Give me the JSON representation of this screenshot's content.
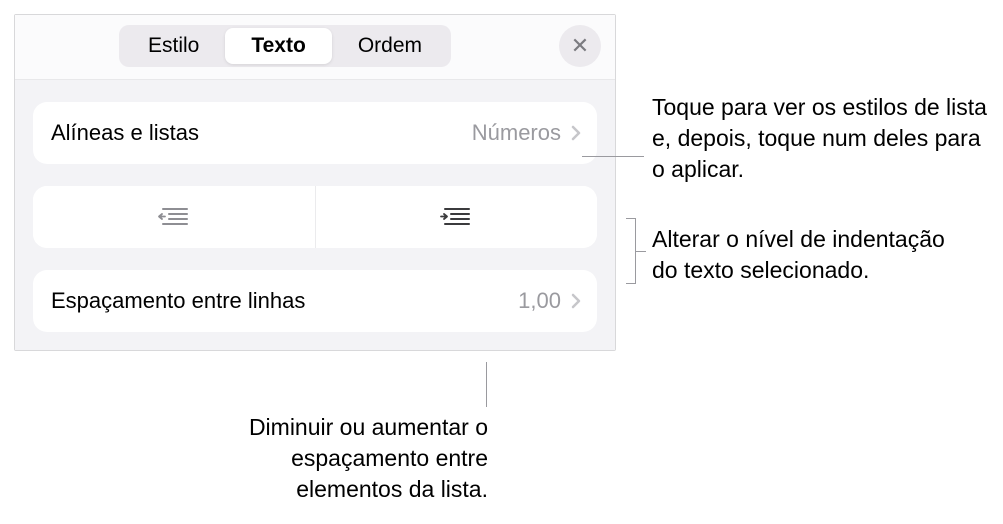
{
  "header": {
    "tabs": {
      "estilo": "Estilo",
      "texto": "Texto",
      "ordem": "Ordem"
    },
    "close_label": "✕"
  },
  "rows": {
    "bullets": {
      "label": "Alíneas e listas",
      "value": "Números"
    },
    "linespacing": {
      "label": "Espaçamento entre linhas",
      "value": "1,00"
    }
  },
  "callouts": {
    "c1": "Toque para ver os estilos de lista e, depois, toque num deles para o aplicar.",
    "c2": "Alterar o nível de indentação do texto selecionado.",
    "c3": "Diminuir ou aumentar o espaçamento entre elementos da lista."
  }
}
